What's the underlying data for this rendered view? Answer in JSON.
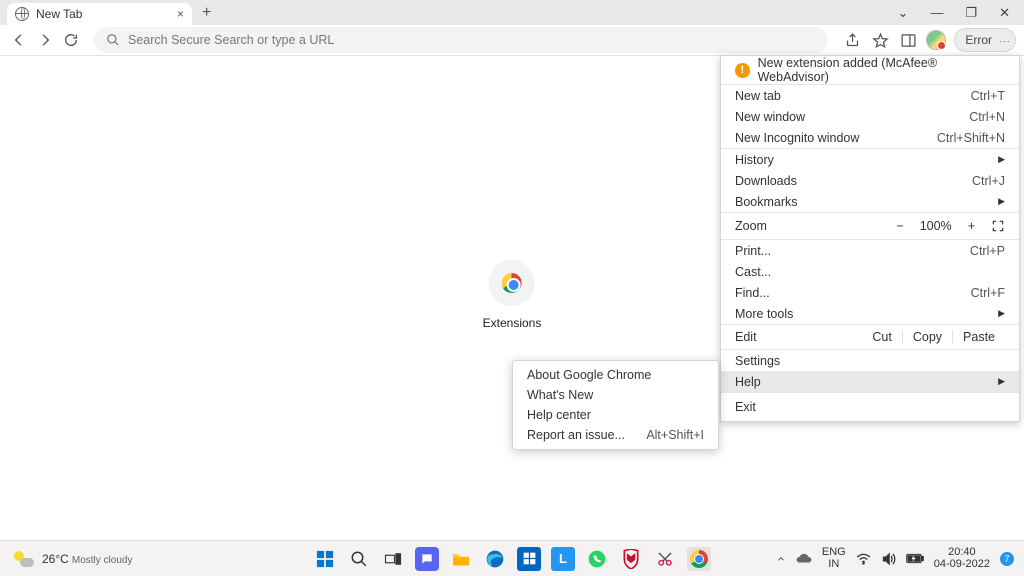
{
  "tab": {
    "title": "New Tab"
  },
  "address_bar": {
    "placeholder": "Search Secure Search or type a URL"
  },
  "toolbar": {
    "error_label": "Error"
  },
  "ntp": {
    "shortcut_label": "Extensions"
  },
  "menu": {
    "notification": "New extension added (McAfee® WebAdvisor)",
    "new_tab": {
      "label": "New tab",
      "shortcut": "Ctrl+T"
    },
    "new_window": {
      "label": "New window",
      "shortcut": "Ctrl+N"
    },
    "new_incognito": {
      "label": "New Incognito window",
      "shortcut": "Ctrl+Shift+N"
    },
    "history": {
      "label": "History"
    },
    "downloads": {
      "label": "Downloads",
      "shortcut": "Ctrl+J"
    },
    "bookmarks": {
      "label": "Bookmarks"
    },
    "zoom": {
      "label": "Zoom",
      "minus": "−",
      "value": "100%",
      "plus": "+"
    },
    "print": {
      "label": "Print...",
      "shortcut": "Ctrl+P"
    },
    "cast": {
      "label": "Cast..."
    },
    "find": {
      "label": "Find...",
      "shortcut": "Ctrl+F"
    },
    "more_tools": {
      "label": "More tools"
    },
    "edit": {
      "label": "Edit",
      "cut": "Cut",
      "copy": "Copy",
      "paste": "Paste"
    },
    "settings": {
      "label": "Settings"
    },
    "help": {
      "label": "Help"
    },
    "exit": {
      "label": "Exit"
    }
  },
  "help_submenu": {
    "about": {
      "label": "About Google Chrome"
    },
    "whats_new": {
      "label": "What's New"
    },
    "help_center": {
      "label": "Help center"
    },
    "report_issue": {
      "label": "Report an issue...",
      "shortcut": "Alt+Shift+I"
    }
  },
  "taskbar": {
    "weather": {
      "temp": "26°C",
      "desc": "Mostly cloudy"
    },
    "lang": {
      "code": "ENG",
      "region": "IN"
    },
    "clock": {
      "time": "20:40",
      "date": "04-09-2022"
    },
    "notif_count": "7"
  }
}
